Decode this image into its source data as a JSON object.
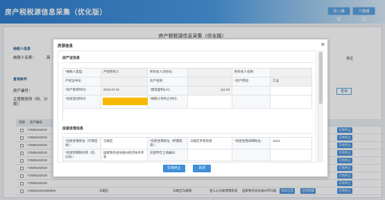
{
  "header": {
    "title": "房产税税源信息采集（优化版）",
    "import_label": "导入模版",
    "download_label": "下载模版"
  },
  "background": {
    "page_title": "房产税税源信息采集（优化版）",
    "taxpayer_section": "纳税人信息",
    "taxpayer_label": "纳税人名称：",
    "taxpayer_name_partial": "商",
    "right_label": "单位",
    "query_section": "查询条件",
    "property_no_label": "房产编号：",
    "main_tax_label": "主管税务所（科、分局）：",
    "query_btn": "查询",
    "table_headers": [
      "选择",
      "房产编号"
    ],
    "row_ids": [
      "F2505152019",
      "F2505152019",
      "F2505152019",
      "F2505152019",
      "F2505152019",
      "F2505152019",
      "F2505152019",
      "F2505152019",
      "F250515201900082"
    ],
    "last_row_cells": [
      "马尾区",
      "马尾区马尾镇",
      "金三从马尾港辖街道",
      "国家税务总局福州市马尾"
    ],
    "op_labels": [
      "交易终止",
      "基本信息",
      "出租明细"
    ]
  },
  "modal": {
    "title": "房源信息",
    "section1": "房产证信息",
    "section2": "房屋坐落信息",
    "fields": {
      "taxpayer_type_label": "*纳税人类型：",
      "taxpayer_type_value": "产权所有人",
      "owner_id_label": "所有权人识别号：",
      "owner_name_label": "所有权人名称：",
      "cert_no_label": "产权证书号：",
      "property_name_label": "房产名称：",
      "usage_label": "*房产用途：",
      "usage_value": "工业",
      "acquire_date_label": "*房产取得时间：",
      "acquire_date_value": "2016-07-01",
      "area_label": "*建筑面积(m²)：",
      "area_value": "111.00",
      "change_date_label": "*房屋变动时间：",
      "tax_end_label": "*纳税义务终止时间："
    },
    "loc_fields": {
      "district_label": "*房屋坐落地址（行政区划）：",
      "district_value": "马尾区",
      "street_label": "*房屋坐落地址（所属街道）：",
      "street_value": "马尾区罗星街道",
      "detail_label": "*房屋坐落详细地址：",
      "detail_value": "11111",
      "tax_office_label": "*房屋所属税务所（科、分局）：",
      "tax_office_value": "国家税务总局福州经济技术开发",
      "unique_label": "房屋所在土地编号："
    },
    "confirm_label": "交易终止",
    "close_label": "关闭"
  },
  "colors": {
    "header_blue": "#2f7fd0",
    "button_blue": "#3d8fd8",
    "highlight_yellow": "#f6b900"
  }
}
